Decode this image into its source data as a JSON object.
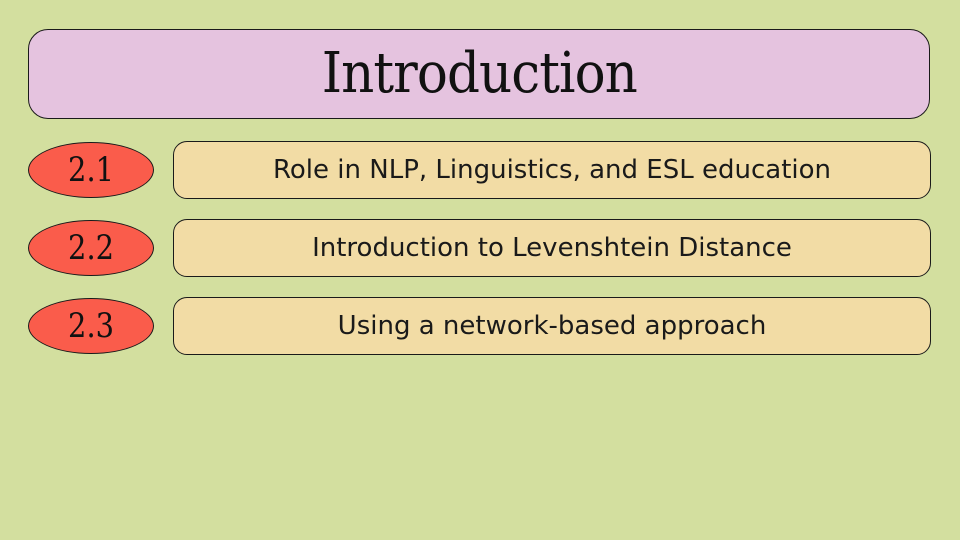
{
  "title": "Introduction",
  "items": [
    {
      "number": "2.1",
      "label": "Role in NLP, Linguistics, and ESL education"
    },
    {
      "number": "2.2",
      "label": "Introduction to Levenshtein Distance"
    },
    {
      "number": "2.3",
      "label": "Using a network-based approach"
    }
  ],
  "colors": {
    "background": "#d3df9f",
    "title_box": "#e5c3df",
    "badge": "#fa5c4b",
    "item_box": "#f2dca5"
  }
}
